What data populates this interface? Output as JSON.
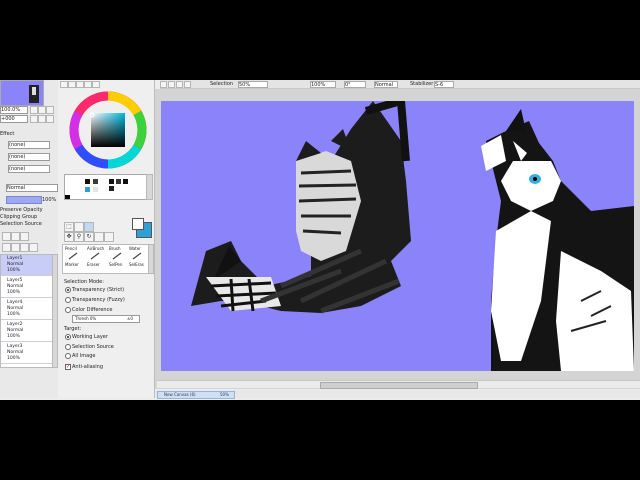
{
  "toolbar": {
    "selection_label": "Selection",
    "selection_value": "50%",
    "zoom_value": "100%",
    "angle_value": "0°",
    "mode_label": "Normal",
    "stabilizer_label": "Stabilizer",
    "stabilizer_value": "S-6"
  },
  "navigator": {
    "zoom_value": "100.0%",
    "angle_value": "+000"
  },
  "left": {
    "effect_label": "Effect",
    "texture_value": "(none)",
    "effect_value": "(none)",
    "extra_value": "(none)",
    "blend_mode": "Normal",
    "opacity": "100%",
    "protect_opacity": "Preserve Opacity",
    "clipping_group": "Clipping Group",
    "selection_source": "Selection Source"
  },
  "layers": [
    {
      "name": "Layer1",
      "mode": "Normal",
      "opacity": "100%",
      "selected": true
    },
    {
      "name": "Layer5",
      "mode": "Normal",
      "opacity": "100%",
      "selected": false
    },
    {
      "name": "Layer4",
      "mode": "Normal",
      "opacity": "100%",
      "selected": false
    },
    {
      "name": "Layer2",
      "mode": "Normal",
      "opacity": "100%",
      "selected": false
    },
    {
      "name": "Layer3",
      "mode": "Normal",
      "opacity": "100%",
      "selected": false
    }
  ],
  "tools": {
    "pencil": "Pencil",
    "airbrush": "AirBrush",
    "brush": "Brush",
    "water": "Water",
    "marker": "Marker",
    "eraser": "Eraser",
    "selpen": "SelPen",
    "seleras": "SelEras"
  },
  "selection_mode": {
    "title": "Selection Mode:",
    "opt1": "Transparency (Strict)",
    "opt2": "Transparency (Fuzzy)",
    "opt3": "Color Difference",
    "threshold": "Thresh 0%",
    "threshold_value": "±0",
    "target_title": "Target:",
    "target1": "Working Layer",
    "target2": "Selection Source",
    "target3": "All Image",
    "antialias": "Anti-aliasing"
  },
  "status": {
    "tab_label": "New Canvas (6)",
    "tab_zoom": "50%"
  },
  "colors": {
    "canvas_bg": "#8b83fa",
    "selected_layer": "#c7cdf6",
    "tool_accent": "#2f9fd6"
  }
}
